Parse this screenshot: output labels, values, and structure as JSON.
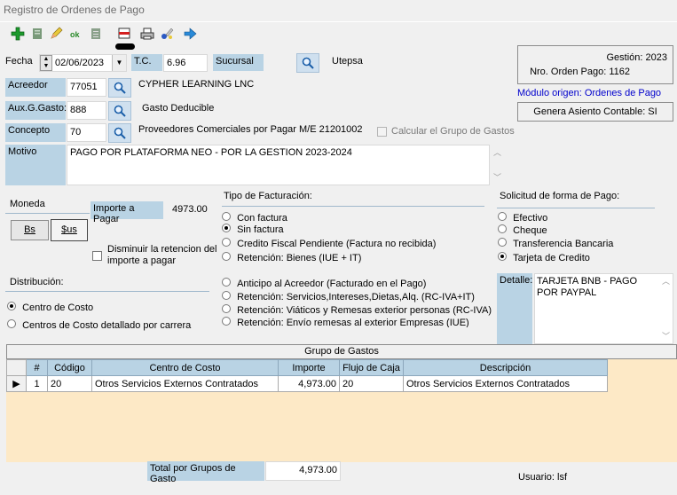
{
  "window": {
    "title": "Registro de Ordenes de Pago"
  },
  "toolbar": {
    "buttons": [
      "add-icon",
      "document-icon",
      "edit-icon",
      "ok-icon",
      "list-icon",
      "delete-icon",
      "print-icon",
      "refresh-icon",
      "exit-icon"
    ]
  },
  "header": {
    "fecha_label": "Fecha",
    "fecha_value": "02/06/2023",
    "tc_label": "T.C.",
    "tc_value": "6.96",
    "sucursal_label": "Sucursal",
    "sucursal_value": "Utepsa",
    "gestion": "Gestión: 2023",
    "nro_orden": "Nro. Orden Pago: 1162",
    "modulo_origen": "Módulo origen: Ordenes de Pago",
    "genera_asiento": "Genera Asiento Contable: SI"
  },
  "form": {
    "acreedor_label": "Acreedor",
    "acreedor_code": "77051",
    "acreedor_name": "CYPHER LEARNING LNC",
    "aux_label": "Aux.G.Gasto:",
    "aux_code": "888",
    "aux_name": "Gasto Deducible",
    "concepto_label": "Concepto",
    "concepto_code": "70",
    "concepto_name": "Proveedores Comerciales por Pagar M/E 21201002",
    "calc_grupo_label": "Calcular el Grupo de Gastos",
    "motivo_label": "Motivo",
    "motivo_value": "PAGO POR PLATAFORMA NEO - POR LA GESTION 2023-2024"
  },
  "moneda": {
    "label": "Moneda",
    "importe_label": "Importe a Pagar",
    "importe_value": "4973.00",
    "bs_button": "Bs",
    "us_button": "$us",
    "disminuir_label": "Disminuir la retencion del importe a pagar"
  },
  "distribucion": {
    "label": "Distribución:",
    "options": [
      "Centro de Costo",
      "Centros de Costo detallado por carrera"
    ],
    "selected": 0
  },
  "facturacion": {
    "label": "Tipo de Facturación:",
    "options_top": [
      "Con factura",
      "Sin factura",
      "Credito Fiscal Pendiente (Factura no recibida)",
      "Retención: Bienes (IUE + IT)"
    ],
    "options_bottom": [
      "Anticipo al Acreedor (Facturado en el Pago)",
      "Retención: Servicios,Intereses,Dietas,Alq. (RC-IVA+IT)",
      "Retención: Viáticos y Remesas exterior personas (RC-IVA)",
      "Retención: Envío remesas al exterior Empresas (IUE)"
    ],
    "selected": 1
  },
  "solicitud": {
    "label": "Solicitud de forma de Pago:",
    "options": [
      "Efectivo",
      "Cheque",
      "Transferencia Bancaria",
      "Tarjeta de Credito"
    ],
    "selected": 3,
    "detalle_label": "Detalle:",
    "detalle_value": "TARJETA BNB - PAGO POR PAYPAL"
  },
  "grupo_gastos": {
    "title": "Grupo de Gastos",
    "columns": [
      "#",
      "Código",
      "Centro de Costo",
      "Importe",
      "Flujo de Caja",
      "Descripción"
    ],
    "rows": [
      {
        "num": "1",
        "codigo": "20",
        "centro": "Otros Servicios Externos Contratados",
        "importe": "4,973.00",
        "flujo": "20",
        "descripcion": "Otros Servicios Externos Contratados"
      }
    ]
  },
  "footer": {
    "total_label": "Total por Grupos de Gasto",
    "total_value": "4,973.00",
    "usuario": "Usuario: lsf"
  },
  "colors": {
    "label_blue": "#b9d3e4",
    "link_blue": "#0000cc",
    "grid_body": "#fde9c6"
  }
}
